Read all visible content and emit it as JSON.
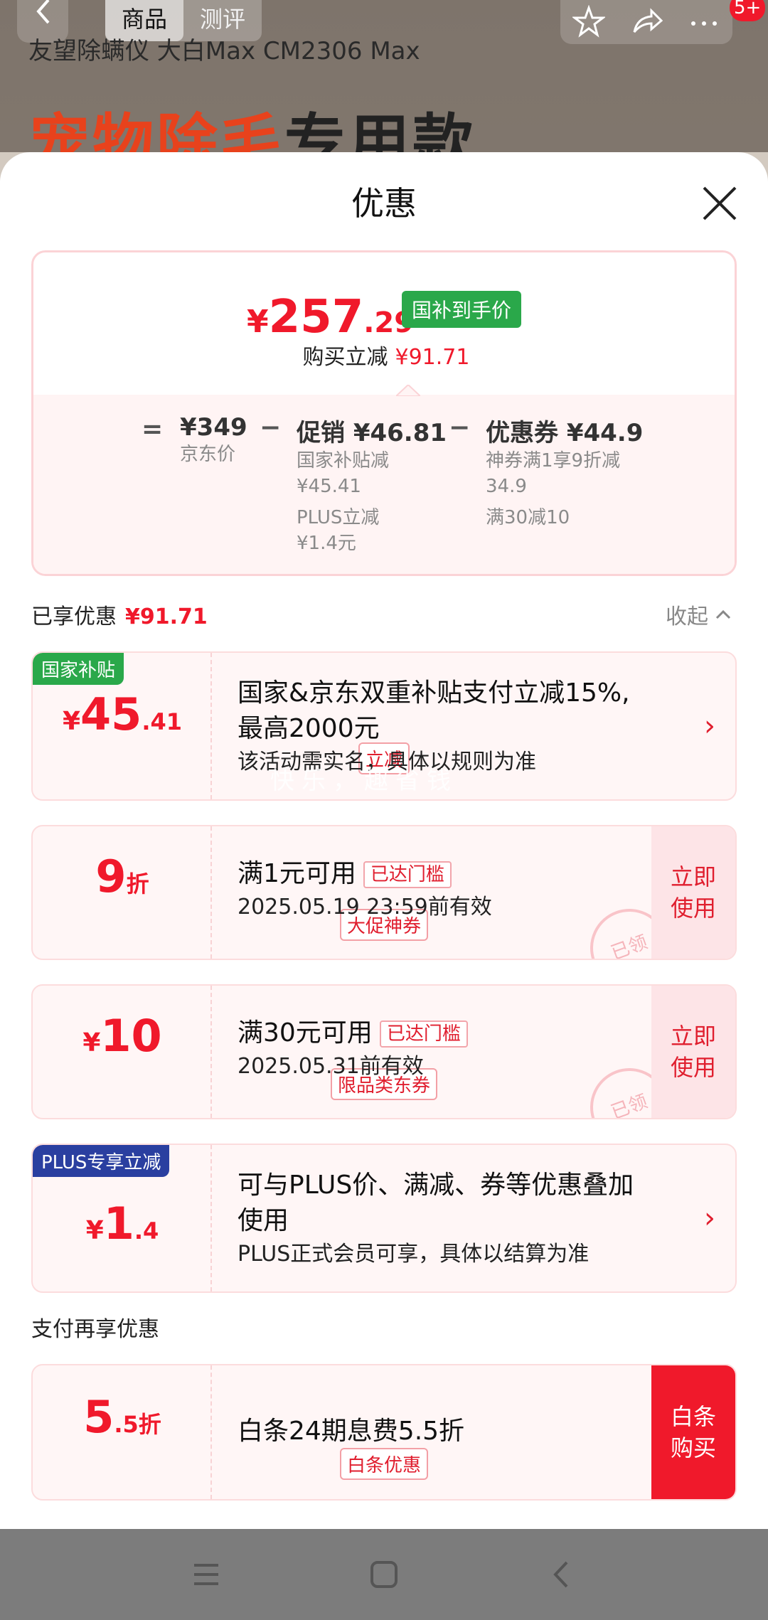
{
  "background": {
    "tabs": [
      "商品",
      "测评"
    ],
    "badge": "5+",
    "product_title": "友望除螨仪 大白Max CM2306 Max",
    "hero_red": "宠物除毛",
    "hero_dark": "专用款"
  },
  "sheet": {
    "title": "优惠",
    "summary": {
      "currency": "¥",
      "price_int": "257",
      "price_dec": ".29",
      "price_tag": "国补到手价",
      "reduce_label": "购买立减",
      "reduce_value": "¥91.71",
      "equals": "=",
      "minus": "−",
      "jd_price": "¥349",
      "jd_price_label": "京东价",
      "promo_label": "促销 ¥46.81",
      "promo_items": [
        "国家补贴减",
        "¥45.41",
        "PLUS立减",
        "¥1.4元"
      ],
      "coupon_label": "优惠券 ¥44.9",
      "coupon_items": [
        "神券满1享9折减",
        "34.9",
        "满30减10"
      ]
    },
    "enjoyed": {
      "label": "已享优惠",
      "value": "¥91.71",
      "collapse": "收起"
    },
    "coupons": [
      {
        "ribbon": "国家补贴",
        "amount_prefix": "¥",
        "amount_main": "45",
        "amount_suffix": ".41",
        "tag": "立减",
        "title_line1": "国家&京东双重补贴支付立减15%,",
        "title_line2": "最高2000元",
        "desc": "该活动需实名，具体以规则为准"
      },
      {
        "amount_main": "9",
        "amount_suffix": "折",
        "tag": "大促神券",
        "title": "满1元可用",
        "threshold": "已达门槛",
        "desc": "2025.05.19 23:59前有效",
        "button_line1": "立即",
        "button_line2": "使用",
        "stamp": "已领"
      },
      {
        "amount_prefix": "¥",
        "amount_main": "10",
        "tag": "限品类东券",
        "title": "满30元可用",
        "threshold": "已达门槛",
        "desc": "2025.05.31前有效",
        "button_line1": "立即",
        "button_line2": "使用",
        "stamp": "已领"
      },
      {
        "ribbon": "PLUS专享立减",
        "amount_prefix": "¥",
        "amount_main": "1",
        "amount_suffix": ".4",
        "title_line1": "可与PLUS价、满减、券等优惠叠加",
        "title_line2": "使用",
        "desc": "PLUS正式会员可享，具体以结算为准"
      }
    ],
    "pay_section": "支付再享优惠",
    "pay_coupon": {
      "amount_main": "5",
      "amount_suffix": ".5折",
      "tag": "白条优惠",
      "title": "白条24期息费5.5折",
      "button_line1": "白条",
      "button_line2": "购买"
    }
  },
  "watermark": "快乐，趣省钱",
  "colors": {
    "accent_red": "#f0192b",
    "green_tag": "#2aa84a",
    "plus_blue": "#2a3fa0",
    "ribbon_green": "#2aa84a"
  }
}
